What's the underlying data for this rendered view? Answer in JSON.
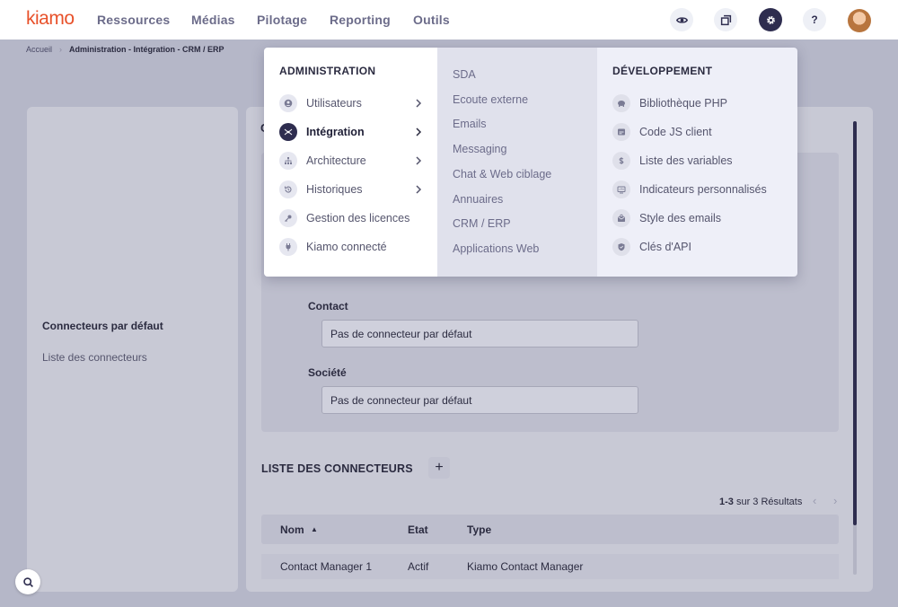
{
  "brand": {
    "logo": "kiamo",
    "accent": "#e8512a"
  },
  "nav": {
    "items": [
      "Ressources",
      "Médias",
      "Pilotage",
      "Reporting",
      "Outils"
    ]
  },
  "header_icons": [
    "eye-icon",
    "windows-icon",
    "gear-icon",
    "help-icon"
  ],
  "help_glyph": "?",
  "breadcrumb": {
    "home": "Accueil",
    "current": "Administration - Intégration - CRM / ERP"
  },
  "left_panel": {
    "title": "Connecteurs par défaut",
    "link": "Liste des connecteurs"
  },
  "main": {
    "c_letter": "C",
    "fields": [
      {
        "label": "Contact",
        "value": "Pas de connecteur par défaut"
      },
      {
        "label": "Société",
        "value": "Pas de connecteur par défaut"
      }
    ],
    "list_title": "LISTE DES CONNECTEURS",
    "add_label": "+",
    "pagination": {
      "range": "1-3",
      "rest": "sur 3 Résultats"
    },
    "table": {
      "columns": [
        "Nom",
        "Etat",
        "Type"
      ],
      "sort_indicator": "▲",
      "rows": [
        {
          "nom": "Contact Manager 1",
          "etat": "Actif",
          "type": "Kiamo Contact Manager"
        }
      ]
    }
  },
  "menu": {
    "administration": {
      "title": "ADMINISTRATION",
      "items": [
        {
          "label": "Utilisateurs",
          "icon": "user-icon",
          "has_sub": true
        },
        {
          "label": "Intégration",
          "icon": "integration-icon",
          "has_sub": true,
          "active": true
        },
        {
          "label": "Architecture",
          "icon": "hierarchy-icon",
          "has_sub": true
        },
        {
          "label": "Historiques",
          "icon": "history-icon",
          "has_sub": true
        },
        {
          "label": "Gestion des licences",
          "icon": "key-icon",
          "has_sub": false
        },
        {
          "label": "Kiamo connecté",
          "icon": "plug-icon",
          "has_sub": false
        }
      ]
    },
    "integration": {
      "items": [
        "SDA",
        "Ecoute externe",
        "Emails",
        "Messaging",
        "Chat & Web ciblage",
        "Annuaires",
        "CRM / ERP",
        "Applications Web"
      ]
    },
    "developpement": {
      "title": "DÉVELOPPEMENT",
      "items": [
        {
          "label": "Bibliothèque PHP",
          "icon": "php-elephant-icon"
        },
        {
          "label": "Code JS client",
          "icon": "code-window-icon"
        },
        {
          "label": "Liste des variables",
          "icon": "dollar-icon"
        },
        {
          "label": "Indicateurs personnalisés",
          "icon": "monitor-icon"
        },
        {
          "label": "Style des emails",
          "icon": "mail-style-icon"
        },
        {
          "label": "Clés d'API",
          "icon": "shield-icon"
        }
      ]
    }
  }
}
